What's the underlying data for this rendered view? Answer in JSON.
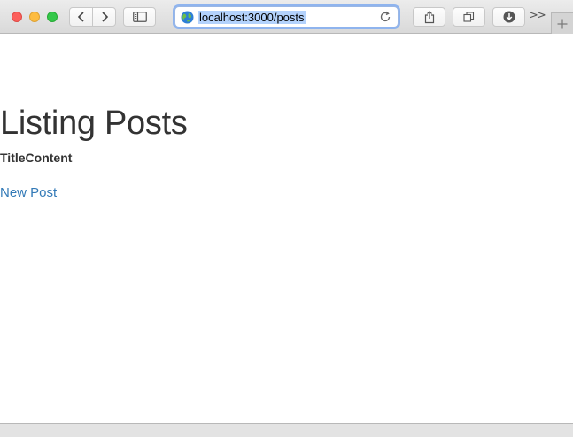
{
  "browser": {
    "url": "localhost:3000/posts",
    "more_label": ">>"
  },
  "page": {
    "title": "Listing Posts",
    "table_headers": [
      "Title",
      "Content"
    ],
    "new_post_link": "New Post"
  },
  "colors": {
    "link": "#337ab7",
    "text": "#333333",
    "url_selection": "#b3d2fc"
  }
}
